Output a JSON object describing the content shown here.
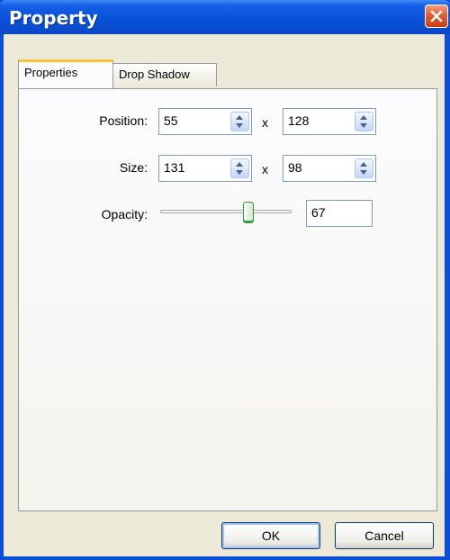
{
  "window": {
    "title": "Property"
  },
  "tabs": [
    {
      "label": "Properties",
      "active": true
    },
    {
      "label": "Drop Shadow",
      "active": false
    }
  ],
  "position": {
    "label": "Position:",
    "x": "55",
    "y": "128",
    "separator": "x"
  },
  "size": {
    "label": "Size:",
    "width": "131",
    "height": "98",
    "separator": "x"
  },
  "opacity": {
    "label": "Opacity:",
    "value": "67",
    "slider_fraction": 0.67
  },
  "buttons": {
    "ok": "OK",
    "cancel": "Cancel"
  },
  "colors": {
    "titlebar": "#0b52dc",
    "client": "#ece9d8",
    "close_button": "#e05a2c",
    "tab_highlight": "#f9c43b",
    "slider_thumb_accent": "#22b14c"
  },
  "icons": {
    "close": "close-x-icon",
    "spin_up": "arrow-up-icon",
    "spin_down": "arrow-down-icon"
  }
}
